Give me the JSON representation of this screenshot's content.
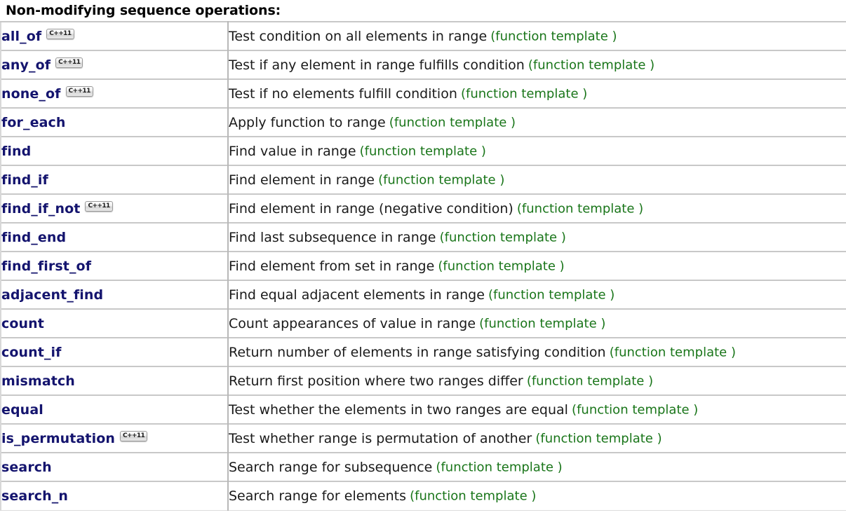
{
  "heading": {
    "text": "Non-modifying sequence operations",
    "colon": ":"
  },
  "badge": {
    "label": "C++11",
    "name": "cpp11-badge"
  },
  "kind_label": "(function template )",
  "colors": {
    "function_link": "#14146e",
    "kind_text": "#197519",
    "name_cell_bg": "#f2f2f2",
    "row_border": "#c8c8c8",
    "heading": "#000000",
    "description": "#1a1a1a"
  },
  "table": {
    "rows": [
      {
        "name": "all_of",
        "cpp11": true,
        "description": "Test condition on all elements in range",
        "kind": "(function template )"
      },
      {
        "name": "any_of",
        "cpp11": true,
        "description": "Test if any element in range fulfills condition",
        "kind": "(function template )"
      },
      {
        "name": "none_of",
        "cpp11": true,
        "description": "Test if no elements fulfill condition",
        "kind": "(function template )"
      },
      {
        "name": "for_each",
        "cpp11": false,
        "description": "Apply function to range",
        "kind": "(function template )"
      },
      {
        "name": "find",
        "cpp11": false,
        "description": "Find value in range",
        "kind": "(function template )"
      },
      {
        "name": "find_if",
        "cpp11": false,
        "description": "Find element in range",
        "kind": "(function template )"
      },
      {
        "name": "find_if_not",
        "cpp11": true,
        "description": "Find element in range (negative condition)",
        "kind": "(function template )"
      },
      {
        "name": "find_end",
        "cpp11": false,
        "description": "Find last subsequence in range",
        "kind": "(function template )"
      },
      {
        "name": "find_first_of",
        "cpp11": false,
        "description": "Find element from set in range",
        "kind": "(function template )"
      },
      {
        "name": "adjacent_find",
        "cpp11": false,
        "description": "Find equal adjacent elements in range",
        "kind": "(function template )"
      },
      {
        "name": "count",
        "cpp11": false,
        "description": "Count appearances of value in range",
        "kind": "(function template )"
      },
      {
        "name": "count_if",
        "cpp11": false,
        "description": "Return number of elements in range satisfying condition",
        "kind": "(function template )"
      },
      {
        "name": "mismatch",
        "cpp11": false,
        "description": "Return first position where two ranges differ",
        "kind": "(function template )"
      },
      {
        "name": "equal",
        "cpp11": false,
        "description": "Test whether the elements in two ranges are equal",
        "kind": "(function template )"
      },
      {
        "name": "is_permutation",
        "cpp11": true,
        "description": "Test whether range is permutation of another",
        "kind": "(function template )"
      },
      {
        "name": "search",
        "cpp11": false,
        "description": "Search range for subsequence",
        "kind": "(function template )"
      },
      {
        "name": "search_n",
        "cpp11": false,
        "description": "Search range for elements",
        "kind": "(function template )"
      }
    ]
  }
}
